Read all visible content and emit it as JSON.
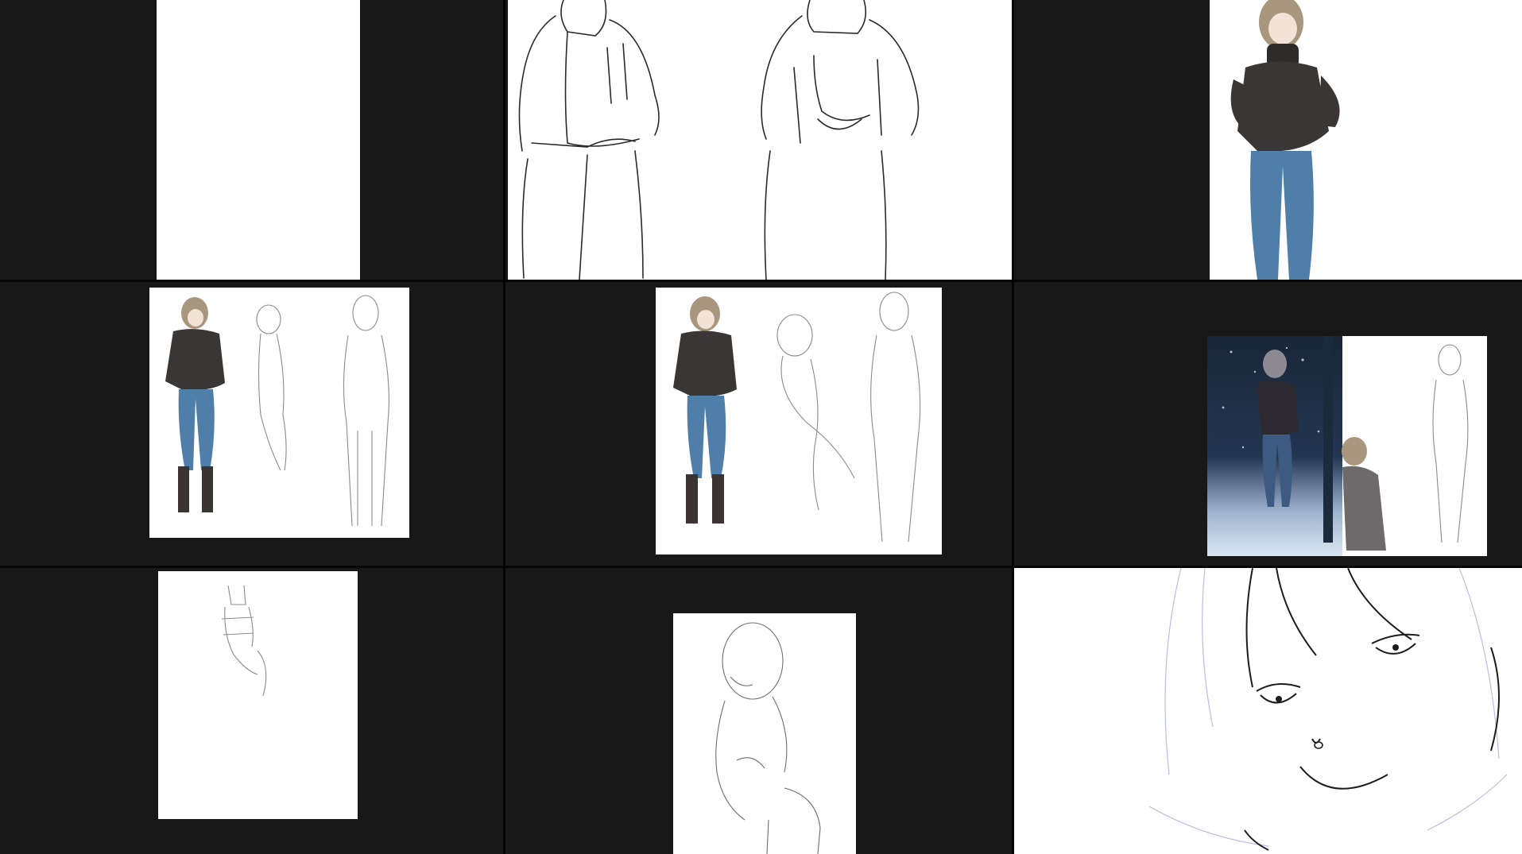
{
  "layout": {
    "panel_count": 9,
    "background_color": "#181818",
    "divider_color": "#050505",
    "canvas_color": "#ffffff"
  },
  "panels": [
    {
      "name": "blank-canvas",
      "content": "blank-white-page"
    },
    {
      "name": "jacket-lineart-closeup",
      "content": "two-figure-lineart"
    },
    {
      "name": "colored-figure-closeup",
      "content": "colored-figure"
    },
    {
      "name": "colored-and-sketches-sheet",
      "content": "reference-sheet"
    },
    {
      "name": "colored-pose-sketches-sheet",
      "content": "reference-sheet"
    },
    {
      "name": "snow-night-scene",
      "content": "illustration-with-sketch"
    },
    {
      "name": "torso-gesture-sketch",
      "content": "rough-sketch"
    },
    {
      "name": "leaning-figure-sketch",
      "content": "rough-sketch"
    },
    {
      "name": "face-lineart-closeup",
      "content": "face-lineart"
    }
  ],
  "palette": {
    "jacket": "#3b3636",
    "jeans": "#4f7ea8",
    "hair": "#a8967e",
    "skin": "#f3e2d6",
    "boots": "#3a3533",
    "line": "#2a2a2a",
    "sketch_line": "#8c8c8c",
    "blue_sketch": "#b9bde8",
    "night_sky": "#1e2c42"
  }
}
